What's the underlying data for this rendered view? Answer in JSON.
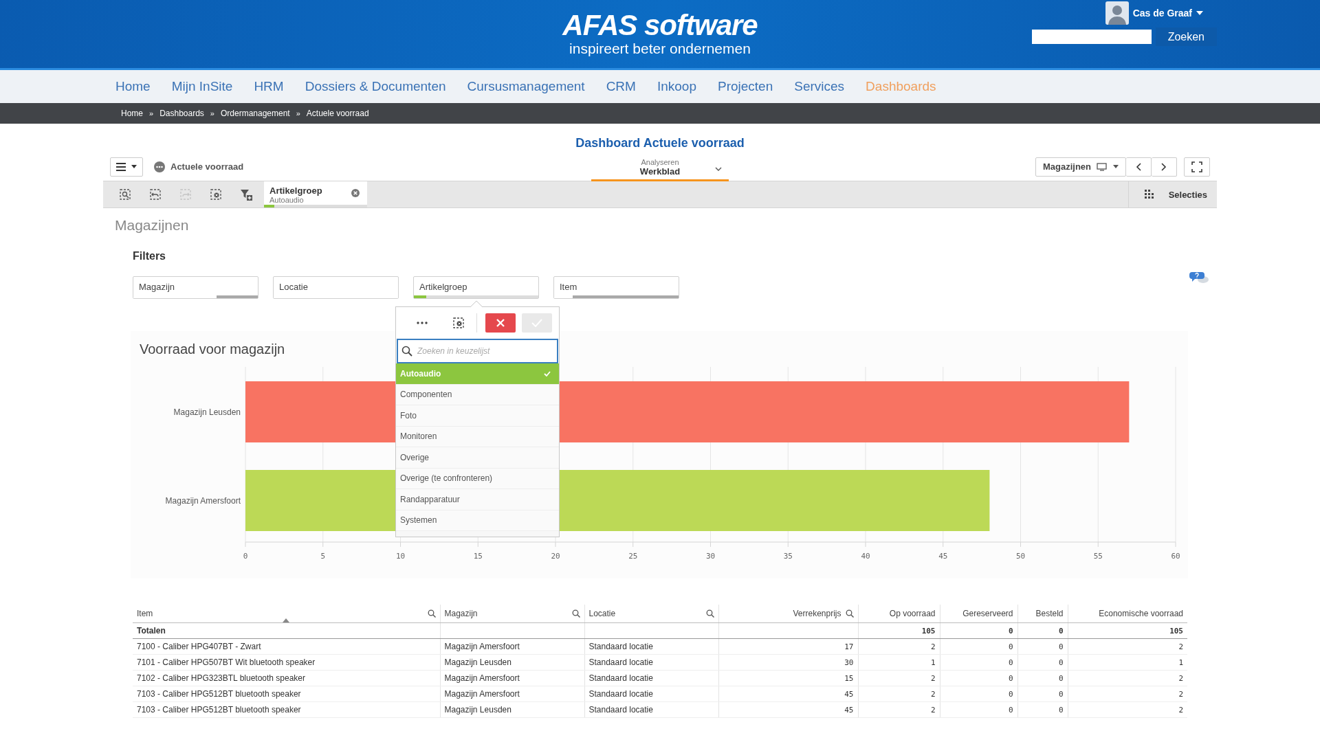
{
  "header": {
    "logo": "AFAS software",
    "tagline": "inspireert beter ondernemen",
    "user": "Cas de Graaf",
    "search_button": "Zoeken"
  },
  "nav": [
    {
      "label": "Home",
      "selected": false
    },
    {
      "label": "Mijn InSite",
      "selected": false
    },
    {
      "label": "HRM",
      "selected": false
    },
    {
      "label": "Dossiers & Documenten",
      "selected": false
    },
    {
      "label": "Cursusmanagement",
      "selected": false
    },
    {
      "label": "CRM",
      "selected": false
    },
    {
      "label": "Inkoop",
      "selected": false
    },
    {
      "label": "Projecten",
      "selected": false
    },
    {
      "label": "Services",
      "selected": false
    },
    {
      "label": "Dashboards",
      "selected": true
    }
  ],
  "breadcrumb": {
    "separator": "»",
    "items": [
      "Home",
      "Dashboards",
      "Ordermanagement",
      "Actuele voorraad"
    ]
  },
  "page_title": "Dashboard Actuele voorraad",
  "toolbar": {
    "app_name": "Actuele voorraad",
    "mode_label": "Analyseren",
    "mode_value": "Werkblad",
    "sheet_button": "Magazijnen"
  },
  "selections_bar": {
    "tools": [
      {
        "kind": "smart-search",
        "disabled": false
      },
      {
        "kind": "back",
        "disabled": false
      },
      {
        "kind": "forward",
        "disabled": true
      },
      {
        "kind": "clear",
        "disabled": false
      },
      {
        "kind": "filter",
        "disabled": false
      }
    ],
    "chips": [
      {
        "field": "Artikelgroep",
        "value": "Autoaudio",
        "level": 0.1
      }
    ],
    "label": "Selecties"
  },
  "sheet_title": "Magazijnen",
  "filters_title": "Filters",
  "filters": [
    {
      "label": "Magazijn",
      "segments": [
        {
          "kind": "possible",
          "level": 0.67
        },
        {
          "kind": "excluded",
          "level": 0.33
        }
      ]
    },
    {
      "label": "Locatie",
      "segments": [
        {
          "kind": "possible",
          "level": 1
        }
      ]
    },
    {
      "label": "Artikelgroep",
      "segments": [
        {
          "kind": "selected",
          "level": 0.1
        },
        {
          "kind": "alternative",
          "level": 0.9
        }
      ]
    },
    {
      "label": "Item",
      "segments": [
        {
          "kind": "possible",
          "level": 0.15
        },
        {
          "kind": "excluded",
          "level": 0.85
        }
      ]
    }
  ],
  "listbox": {
    "placeholder": "Zoeken in keuzelijst",
    "items": [
      {
        "label": "Autoaudio",
        "selected": true
      },
      {
        "label": "Componenten",
        "selected": false
      },
      {
        "label": "Foto",
        "selected": false
      },
      {
        "label": "Monitoren",
        "selected": false
      },
      {
        "label": "Overige",
        "selected": false
      },
      {
        "label": "Overige (te confronteren)",
        "selected": false
      },
      {
        "label": "Randapparatuur",
        "selected": false
      },
      {
        "label": "Systemen",
        "selected": false
      }
    ]
  },
  "chart": {
    "chart_data": {
      "type": "bar",
      "orientation": "horizontal",
      "stacked": true,
      "grid": true,
      "title": "Voorraad voor magazijn",
      "categories": [
        "Magazijn Leusden",
        "Magazijn Amersfoort"
      ],
      "series": [
        {
          "color": "#f87362",
          "values": [
            57,
            null
          ]
        },
        {
          "color": "#bcd956",
          "values": [
            null,
            48
          ]
        }
      ],
      "xlim": [
        0,
        60
      ],
      "xticks": [
        0,
        5,
        10,
        15,
        20,
        25,
        30,
        35,
        40,
        45,
        50,
        55,
        60
      ]
    }
  },
  "table": {
    "columns": [
      {
        "label": "Item",
        "kind": "text",
        "searchable": true,
        "sorted": true
      },
      {
        "label": "Magazijn",
        "kind": "text",
        "searchable": true,
        "sorted": false
      },
      {
        "label": "Locatie",
        "kind": "text",
        "searchable": true,
        "sorted": false
      },
      {
        "label": "Verrekenprijs",
        "kind": "number",
        "searchable": true,
        "sorted": false
      },
      {
        "label": "Op voorraad",
        "kind": "number",
        "searchable": false,
        "sorted": false
      },
      {
        "label": "Gereserveerd",
        "kind": "number",
        "searchable": false,
        "sorted": false
      },
      {
        "label": "Besteld",
        "kind": "number",
        "searchable": false,
        "sorted": false
      },
      {
        "label": "Economische voorraad",
        "kind": "number",
        "searchable": false,
        "sorted": false
      }
    ],
    "totals": {
      "label": "Totalen",
      "values": [
        "105",
        "0",
        "0",
        "105"
      ]
    },
    "rows": [
      [
        "7100 - Caliber HPG407BT - Zwart",
        "Magazijn Amersfoort",
        "Standaard locatie",
        "17",
        "2",
        "0",
        "0",
        "2"
      ],
      [
        "7101 - Caliber HPG507BT Wit bluetooth speaker",
        "Magazijn Leusden",
        "Standaard locatie",
        "30",
        "1",
        "0",
        "0",
        "1"
      ],
      [
        "7102 - Caliber HPG323BTL bluetooth speaker",
        "Magazijn Amersfoort",
        "Standaard locatie",
        "15",
        "2",
        "0",
        "0",
        "2"
      ],
      [
        "7103 - Caliber HPG512BT bluetooth speaker",
        "Magazijn Amersfoort",
        "Standaard locatie",
        "45",
        "2",
        "0",
        "0",
        "2"
      ],
      [
        "7103 - Caliber HPG512BT bluetooth speaker",
        "Magazijn Leusden",
        "Standaard locatie",
        "45",
        "2",
        "0",
        "0",
        "2"
      ]
    ]
  }
}
